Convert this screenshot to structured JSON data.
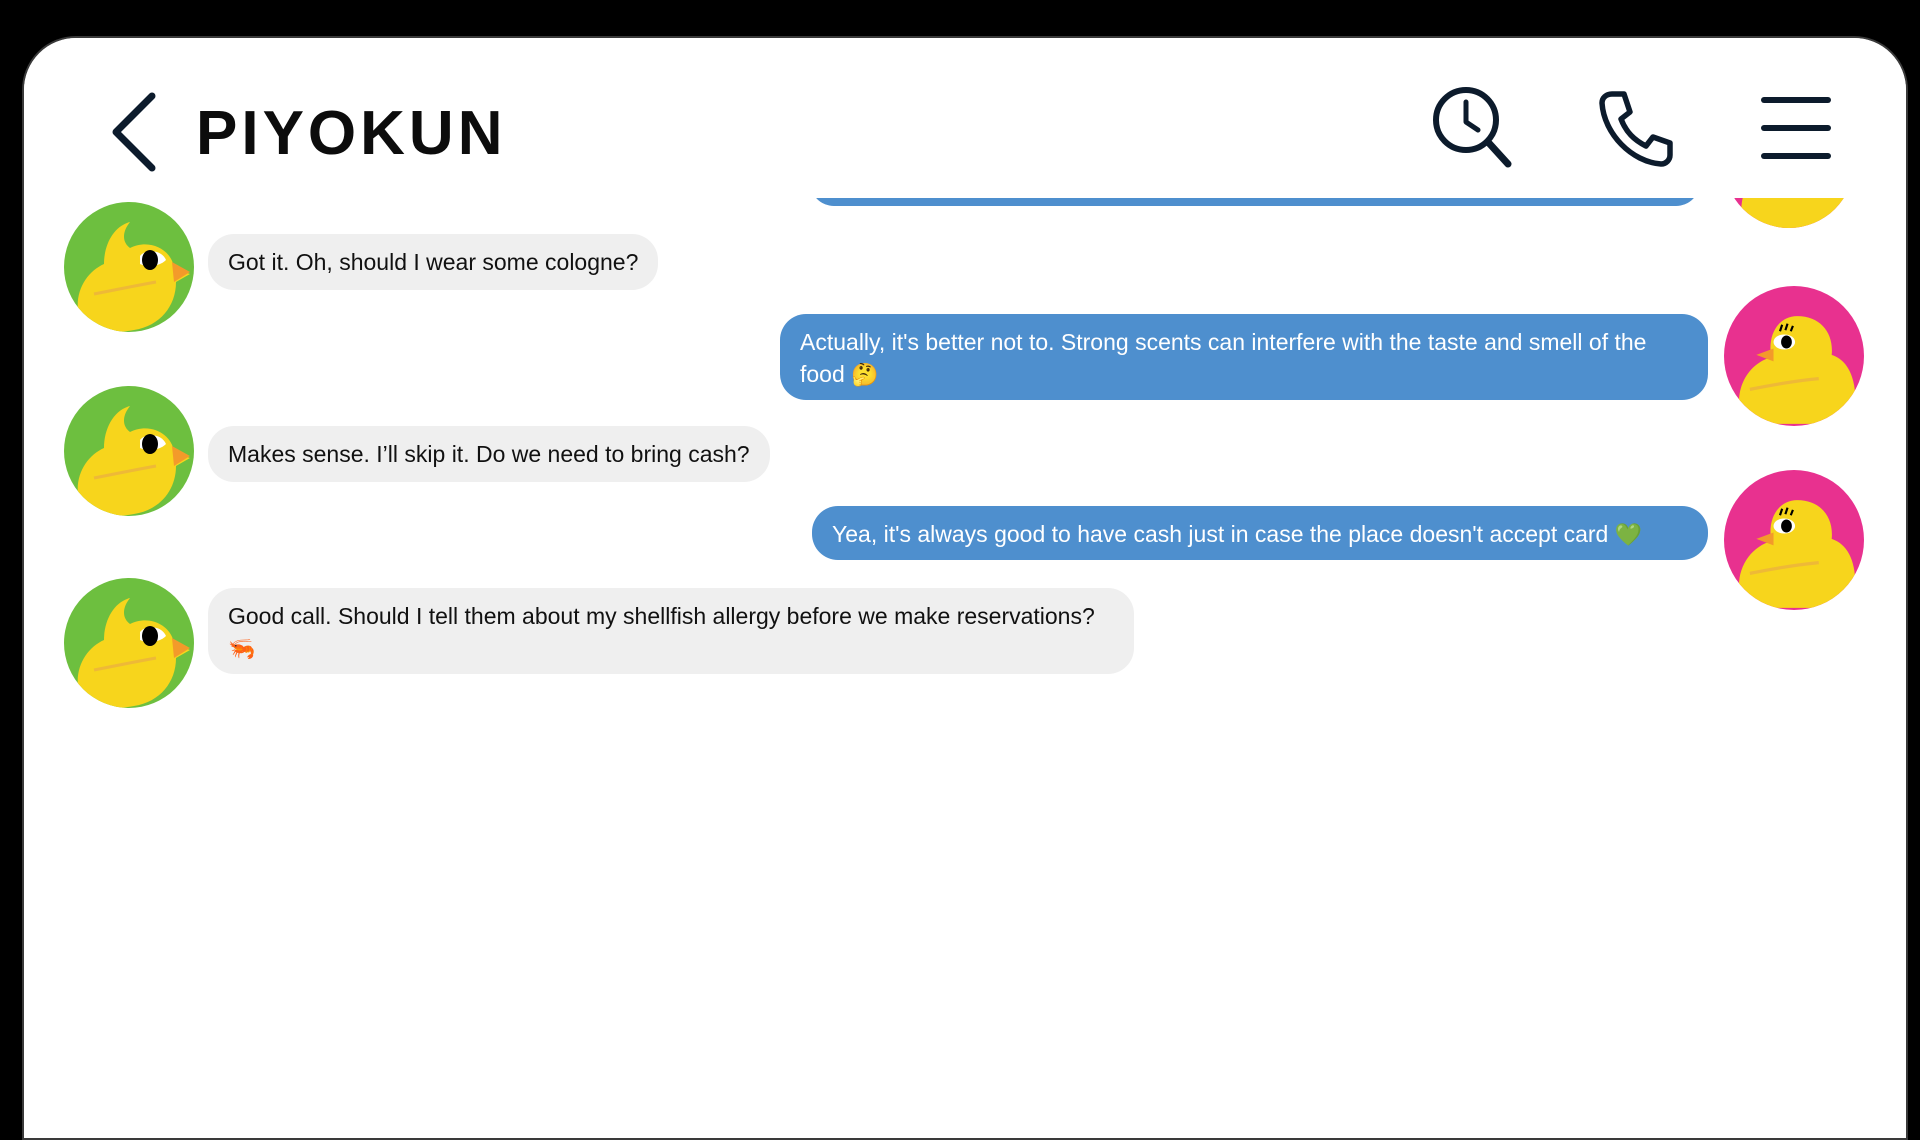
{
  "header": {
    "title": "PIYOKUN",
    "back_icon": "chevron-left-icon",
    "search_icon": "history-search-icon",
    "call_icon": "phone-icon",
    "menu_icon": "hamburger-menu-icon"
  },
  "colors": {
    "outgoing_bubble": "#4e8fce",
    "incoming_bubble": "#efefef",
    "contact_avatar_bg": "#6dbf3f",
    "user_avatar_bg": "#e8318f",
    "chick_yellow": "#f7d51c"
  },
  "messages": [
    {
      "side": "incoming",
      "text": "Got it. Oh, should I wear some cologne?",
      "emoji": ""
    },
    {
      "side": "outgoing",
      "text": "Actually, it's better not to. Strong scents can interfere with the taste and smell of the food",
      "emoji": "🤔"
    },
    {
      "side": "incoming",
      "text": "Makes sense. I’ll skip it. Do we need to bring cash?",
      "emoji": ""
    },
    {
      "side": "outgoing",
      "text": "Yea, it's always good to have cash just in case the place doesn't accept card",
      "emoji": "💚"
    },
    {
      "side": "incoming",
      "text": "Good call. Should I tell them about my shellfish allergy before we make reservations?",
      "emoji": "🦐"
    }
  ]
}
